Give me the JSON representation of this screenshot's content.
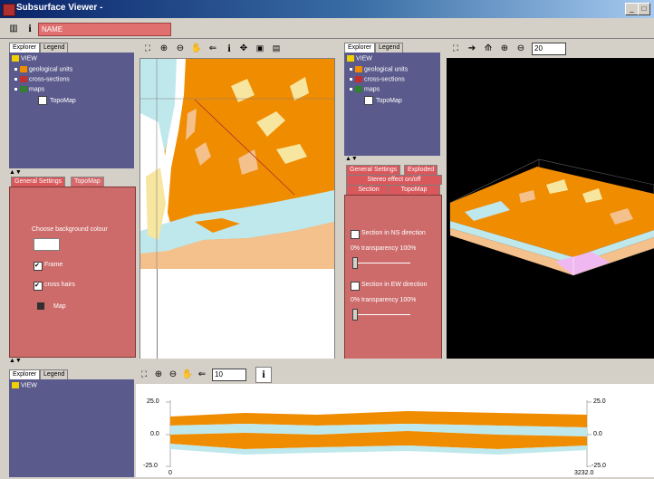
{
  "window": {
    "title": "Subsurface Viewer -",
    "min": "_",
    "max": "□",
    "close": "×"
  },
  "toolbar": {
    "name_value": "NAME",
    "info": "i"
  },
  "left_explorer": {
    "tabs": [
      "Explorer",
      "Legend"
    ],
    "root": "VIEW",
    "items": [
      "geological units",
      "cross-sections",
      "maps"
    ],
    "subitem": "TopoMap"
  },
  "left_settings": {
    "tabs": [
      "General Settings",
      "TopoMap"
    ],
    "bg_label": "Choose background colour",
    "frame_label": "Frame",
    "crosshairs_label": "cross hairs",
    "map_label": "Map"
  },
  "map_toolbar": {
    "icons": [
      "zoom-extent-icon",
      "zoom-in-icon",
      "zoom-out-icon",
      "pan-icon",
      "back-icon",
      "info-icon",
      "select-icon",
      "export-icon",
      "print-icon"
    ]
  },
  "mid_explorer": {
    "tabs": [
      "Explorer",
      "Legend"
    ],
    "root": "VIEW",
    "items": [
      "geological units",
      "cross-sections",
      "maps"
    ],
    "subitem": "TopoMap"
  },
  "mid_settings": {
    "tabs_row1": [
      "General Settings",
      "Exploded"
    ],
    "tabs_row2": "Stereo effect on/off",
    "tabs_row3": [
      "Section",
      "TopoMap"
    ],
    "ns_label": "Section in NS direction",
    "ns_transparency": "0% transparency 100%",
    "ew_label": "Section in EW direction",
    "ew_transparency": "0% transparency 100%"
  },
  "view3d_toolbar": {
    "zoom_value": "20"
  },
  "bottom_explorer": {
    "tabs": [
      "Explorer",
      "Legend"
    ],
    "root": "VIEW"
  },
  "section_toolbar": {
    "zoom_value": "10",
    "info": "i"
  },
  "section_chart": {
    "y_ticks_left": [
      "25.0",
      "0.0",
      "-25.0"
    ],
    "y_ticks_right": [
      "25.0",
      "0.0",
      "-25.0"
    ],
    "x_start": "0",
    "x_end": "3232.0"
  },
  "colors": {
    "orange": "#f08c00",
    "lightblue": "#bfe8ec",
    "peach": "#f4c08c",
    "purple": "#5a5a8c",
    "red": "#cd6b6b"
  }
}
